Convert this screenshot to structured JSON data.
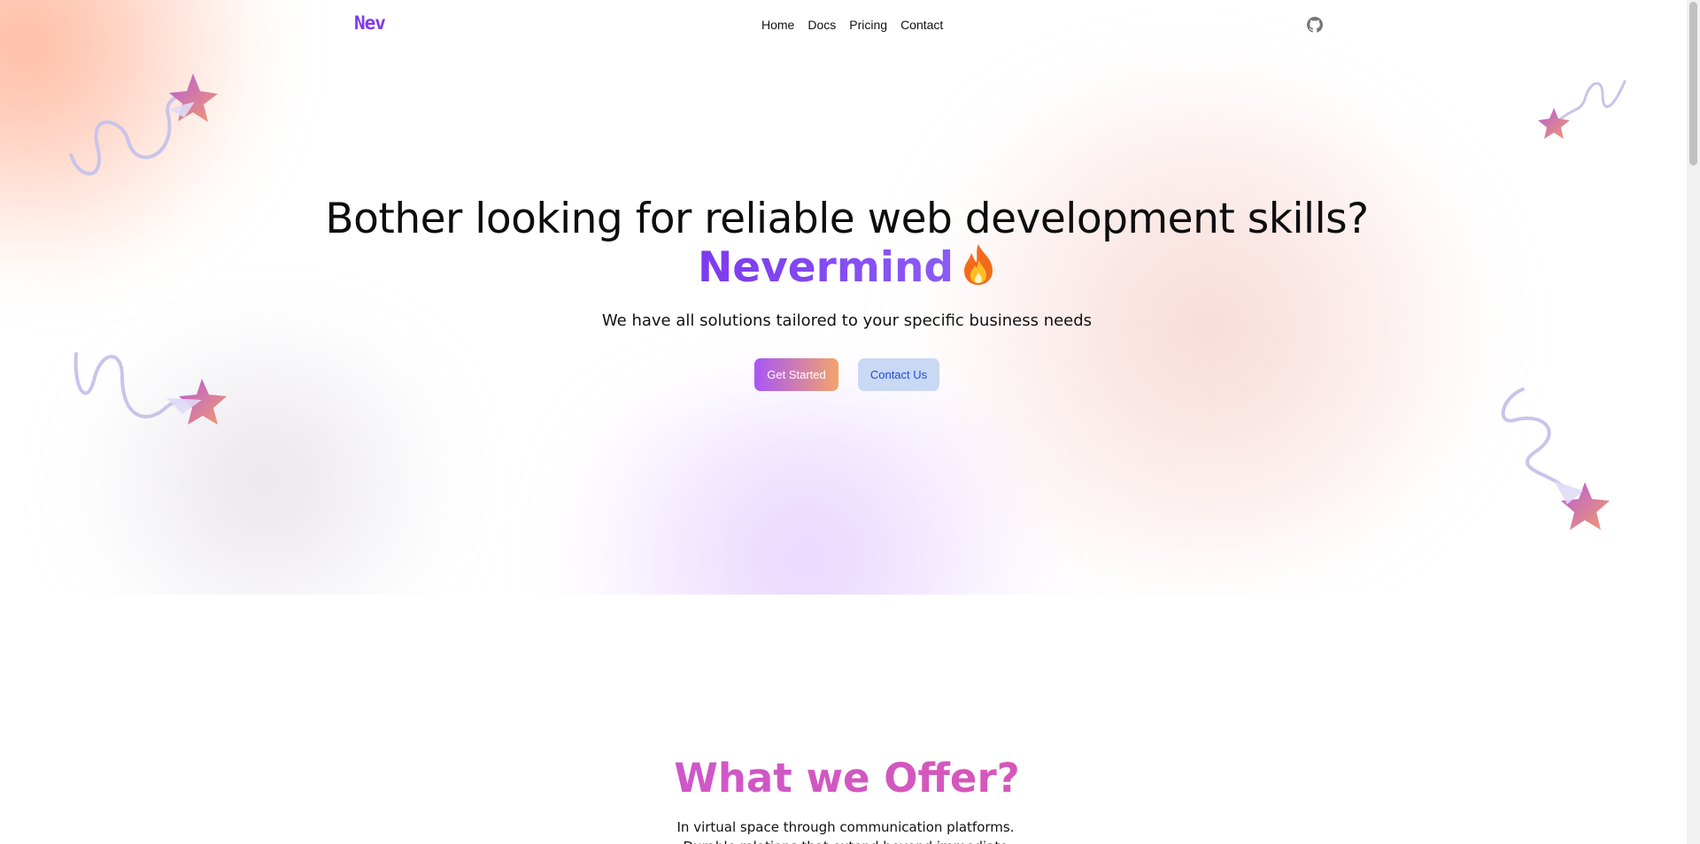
{
  "nav": {
    "logo": "Nev",
    "links": [
      "Home",
      "Docs",
      "Pricing",
      "Contact"
    ],
    "github_icon": "github-icon"
  },
  "hero": {
    "headline": "Bother looking for reliable web development skills?",
    "brand": "Nevermind",
    "brand_emoji_icon": "fire-icon",
    "subtitle": "We have all solutions tailored to your specific business needs",
    "primary_button": "Get Started",
    "secondary_button": "Contact Us"
  },
  "offer": {
    "title": "What we Offer?",
    "text": "In virtual space through communication platforms. Durable relations that extend beyond immediate genealogical ties"
  },
  "colors": {
    "accent": "#7c3aed",
    "gradient_start": "#a855f7",
    "gradient_end": "#f4a46b",
    "secondary_button_bg": "#c9d8f3",
    "secondary_button_text": "#1d4ed8"
  }
}
